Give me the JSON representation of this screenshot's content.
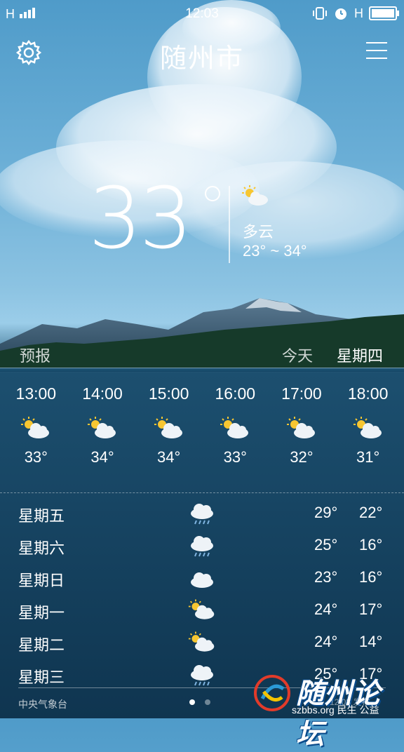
{
  "status_bar": {
    "network": "H",
    "time": "12:03",
    "sim2": "H",
    "battery_level": 0.9
  },
  "header": {
    "city": "随州市",
    "settings_icon": "gear-icon",
    "menu_icon": "menu-icon"
  },
  "current": {
    "temperature": "33",
    "condition": "多云",
    "range": "23° ~ 34°",
    "icon": "partly-cloudy-icon"
  },
  "tabs": {
    "forecast": "预报",
    "today": "今天",
    "weekday": "星期四"
  },
  "hourly": [
    {
      "time": "13:00",
      "temp": "33°",
      "icon": "partly-cloudy-icon"
    },
    {
      "time": "14:00",
      "temp": "34°",
      "icon": "partly-cloudy-icon"
    },
    {
      "time": "15:00",
      "temp": "34°",
      "icon": "partly-cloudy-icon"
    },
    {
      "time": "16:00",
      "temp": "33°",
      "icon": "partly-cloudy-icon"
    },
    {
      "time": "17:00",
      "temp": "32°",
      "icon": "partly-cloudy-icon"
    },
    {
      "time": "18:00",
      "temp": "31°",
      "icon": "partly-cloudy-icon"
    }
  ],
  "daily": [
    {
      "day": "星期五",
      "high": "29°",
      "low": "22°",
      "icon": "rain-icon"
    },
    {
      "day": "星期六",
      "high": "25°",
      "low": "16°",
      "icon": "rain-icon"
    },
    {
      "day": "星期日",
      "high": "23°",
      "low": "16°",
      "icon": "cloud-icon"
    },
    {
      "day": "星期一",
      "high": "24°",
      "low": "17°",
      "icon": "partly-cloudy-icon"
    },
    {
      "day": "星期二",
      "high": "24°",
      "low": "14°",
      "icon": "partly-cloudy-icon"
    },
    {
      "day": "星期三",
      "high": "25°",
      "low": "17°",
      "icon": "rain-icon"
    }
  ],
  "footer": {
    "source": "中央气象台",
    "pages": 2,
    "active_page": 1
  },
  "watermark": {
    "title": "随州论坛",
    "subtitle": "szbbs.org 民生 公益",
    "stamp": "12:03 发布"
  }
}
